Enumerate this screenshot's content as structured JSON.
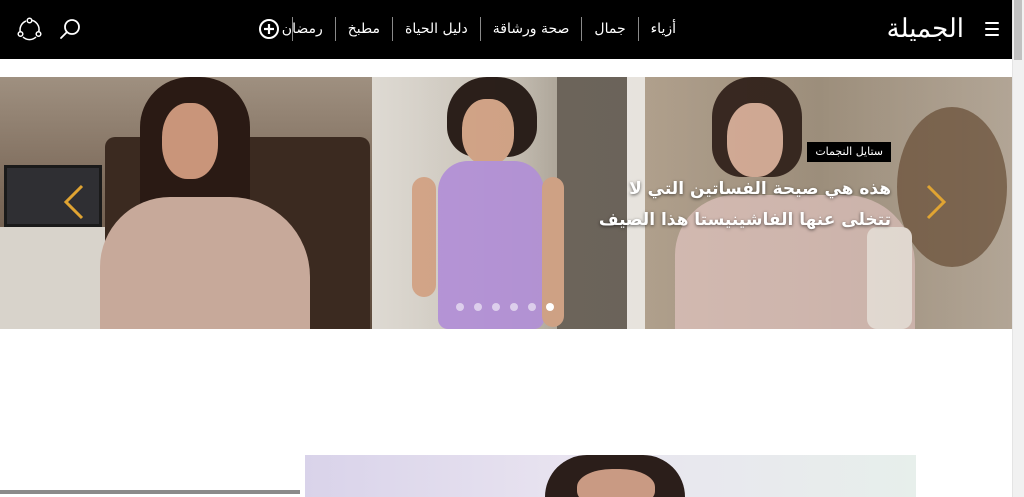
{
  "header": {
    "logo_text": "الجميلة",
    "nav": [
      "أزياء",
      "جمال",
      "صحة ورشاقة",
      "دليل الحياة",
      "مطبخ",
      "رمضان"
    ],
    "icons": [
      "menu-icon",
      "plus-circle-icon",
      "search-icon",
      "share-icon"
    ]
  },
  "slider": {
    "category": "ستايل النجمات",
    "headline": "هذه هي صيحة الفساتين التي لا تتخلى عنها الفاشينيستا هذا الصيف",
    "slide_count": 6,
    "active_slide": 6,
    "arrow_color": "#e0a432"
  },
  "colors": {
    "header_bg": "#000000",
    "accent": "#e0a432"
  }
}
